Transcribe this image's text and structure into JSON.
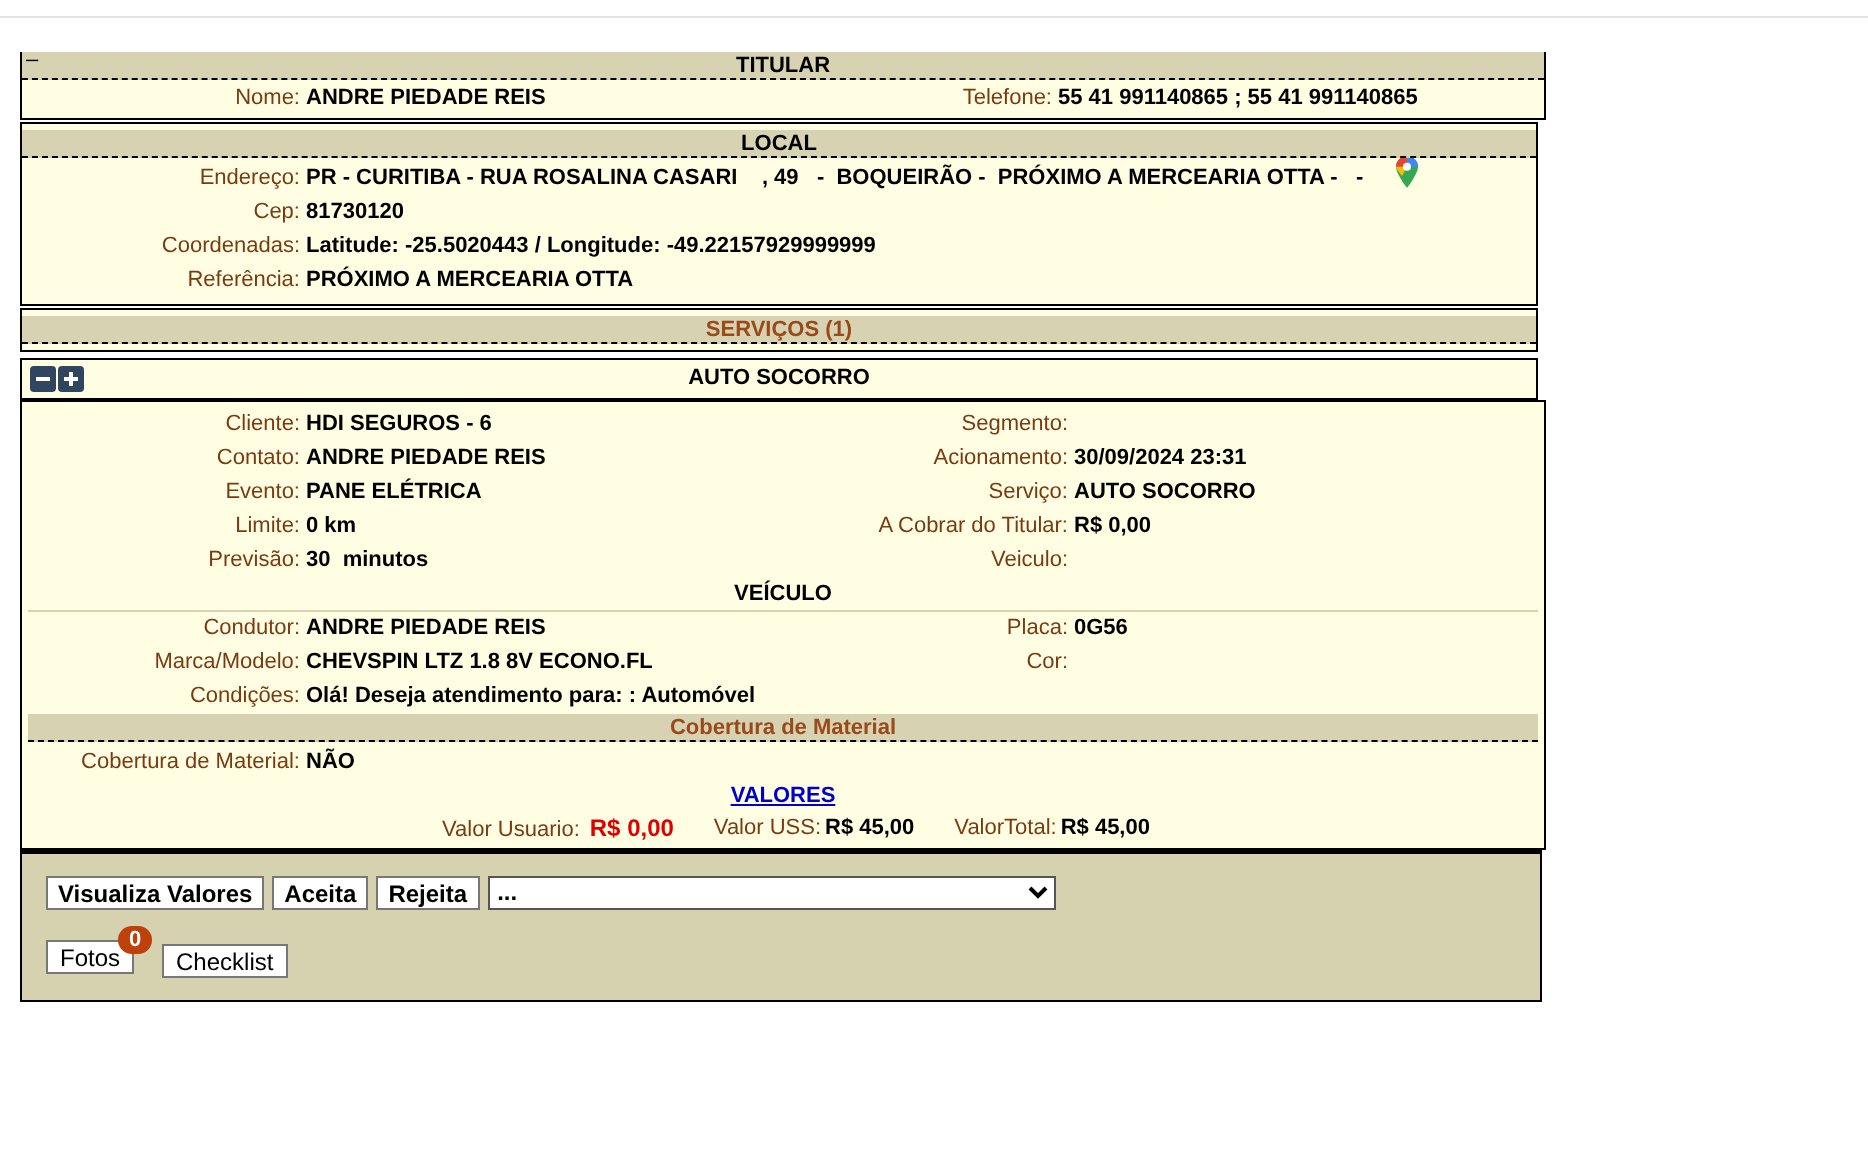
{
  "titular": {
    "toggle": "–",
    "title": "TITULAR",
    "name": {
      "label": "Nome:",
      "value": "ANDRE PIEDADE REIS"
    },
    "phone": {
      "label": "Telefone:",
      "value": "55 41 991140865 ; 55 41 991140865"
    }
  },
  "local": {
    "title": "LOCAL",
    "fields": [
      {
        "label": "Endereço:",
        "value": "PR - CURITIBA - RUA ROSALINA CASARI    , 49   -  BOQUEIRÃO -  PRÓXIMO A MERCEARIA OTTA -   -",
        "map": true
      },
      {
        "label": "Cep:",
        "value": "81730120"
      },
      {
        "label": "Coordenadas:",
        "value": "Latitude: -25.5020443 / Longitude: -49.22157929999999"
      },
      {
        "label": "Referência:",
        "value": "PRÓXIMO A MERCEARIA OTTA"
      }
    ]
  },
  "servicos": {
    "title": "SERVIÇOS (1)"
  },
  "service": {
    "title": "AUTO SOCORRO"
  },
  "details": [
    {
      "left": {
        "label": "Cliente:",
        "value": "HDI SEGUROS - 6"
      },
      "right": {
        "label": "Segmento:"
      }
    },
    {
      "left": {
        "label": "Contato:",
        "value": "ANDRE PIEDADE REIS"
      },
      "right": {
        "label": "Acionamento:",
        "value": "30/09/2024 23:31"
      }
    },
    {
      "left": {
        "label": "Evento:",
        "value": "PANE ELÉTRICA"
      },
      "right": {
        "label": "Serviço:",
        "value": "AUTO SOCORRO"
      }
    },
    {
      "left": {
        "label": "Limite:",
        "value": "0 km"
      },
      "right": {
        "label": "A Cobrar do Titular:",
        "value": "R$ 0,00"
      }
    },
    {
      "left": {
        "label": "Previsão:",
        "value": "30  minutos"
      },
      "right": {
        "label": "Veiculo:"
      }
    }
  ],
  "vehicle": {
    "title": "VEÍCULO",
    "rows": [
      {
        "left": {
          "label": "Condutor:",
          "value": "ANDRE PIEDADE REIS"
        },
        "right": {
          "label": "Placa:",
          "value": "0G56"
        }
      },
      {
        "left": {
          "label": "Marca/Modelo:",
          "value": "CHEVSPIN LTZ 1.8 8V ECONO.FL"
        },
        "right": {
          "label": "Cor:"
        }
      },
      {
        "left": {
          "label": "Condições:",
          "value": "Olá! Deseja atendimento para: : Automóvel"
        }
      }
    ]
  },
  "coverage": {
    "title": "Cobertura de Material",
    "fields": [
      {
        "label": "Cobertura de Material:",
        "value": "NÃO"
      }
    ]
  },
  "values": {
    "link": "VALORES",
    "items": [
      {
        "label": "Valor Usuario:",
        "value": "R$ 0,00",
        "kind": "alert"
      },
      {
        "label": "Valor USS:",
        "value": "R$ 45,00",
        "kind": "normal"
      },
      {
        "label": "ValorTotal:",
        "value": "R$ 45,00",
        "kind": "normal"
      }
    ]
  },
  "actions": {
    "buttons": [
      "Visualiza Valores",
      "Aceita",
      "Rejeita"
    ],
    "select": {
      "value": "..."
    },
    "photos": {
      "label": "Fotos",
      "count": "0"
    },
    "checklist": "Checklist"
  }
}
